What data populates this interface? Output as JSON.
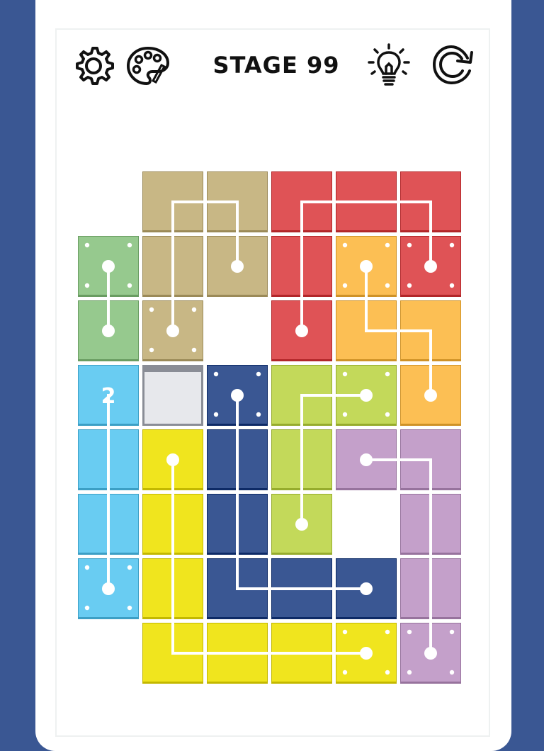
{
  "header": {
    "stage_label": "STAGE 99",
    "settings_icon": "gear-icon",
    "palette_icon": "palette-icon",
    "hint_icon": "lightbulb-icon",
    "restart_icon": "restart-icon"
  },
  "colors": {
    "background": "#3a5793",
    "tan": "#c8b785",
    "red": "#df5356",
    "green": "#96c98e",
    "orange": "#fcbf54",
    "lime": "#c3d95a",
    "navy": "#3a5793",
    "sky": "#69ccf2",
    "yellow": "#f0e51e",
    "purple": "#c4a0ca",
    "empty": "#e7e8ec",
    "path_line": "#ffffff"
  },
  "board": {
    "rows": 8,
    "cols": 6,
    "tiles": [
      {
        "r": 0,
        "c": 1,
        "color": "tan"
      },
      {
        "r": 0,
        "c": 2,
        "color": "tan"
      },
      {
        "r": 0,
        "c": 3,
        "color": "red"
      },
      {
        "r": 0,
        "c": 4,
        "color": "red"
      },
      {
        "r": 0,
        "c": 5,
        "color": "red"
      },
      {
        "r": 1,
        "c": 0,
        "color": "green",
        "endpoint": true
      },
      {
        "r": 1,
        "c": 1,
        "color": "tan"
      },
      {
        "r": 1,
        "c": 2,
        "color": "tan"
      },
      {
        "r": 1,
        "c": 3,
        "color": "red"
      },
      {
        "r": 1,
        "c": 4,
        "color": "orange",
        "endpoint": true
      },
      {
        "r": 1,
        "c": 5,
        "color": "red",
        "endpoint": true
      },
      {
        "r": 2,
        "c": 0,
        "color": "green"
      },
      {
        "r": 2,
        "c": 1,
        "color": "tan",
        "endpoint": true
      },
      {
        "r": 2,
        "c": 3,
        "color": "red"
      },
      {
        "r": 2,
        "c": 4,
        "color": "orange"
      },
      {
        "r": 2,
        "c": 5,
        "color": "orange"
      },
      {
        "r": 3,
        "c": 0,
        "color": "sky",
        "label": "2"
      },
      {
        "r": 3,
        "c": 1,
        "color": "empty"
      },
      {
        "r": 3,
        "c": 2,
        "color": "navy",
        "endpoint": true
      },
      {
        "r": 3,
        "c": 3,
        "color": "lime"
      },
      {
        "r": 3,
        "c": 4,
        "color": "lime",
        "endpoint": true
      },
      {
        "r": 3,
        "c": 5,
        "color": "orange"
      },
      {
        "r": 4,
        "c": 0,
        "color": "sky"
      },
      {
        "r": 4,
        "c": 1,
        "color": "yellow"
      },
      {
        "r": 4,
        "c": 2,
        "color": "navy"
      },
      {
        "r": 4,
        "c": 3,
        "color": "lime"
      },
      {
        "r": 4,
        "c": 4,
        "color": "purple"
      },
      {
        "r": 4,
        "c": 5,
        "color": "purple"
      },
      {
        "r": 5,
        "c": 0,
        "color": "sky"
      },
      {
        "r": 5,
        "c": 1,
        "color": "yellow"
      },
      {
        "r": 5,
        "c": 2,
        "color": "navy"
      },
      {
        "r": 5,
        "c": 3,
        "color": "lime"
      },
      {
        "r": 5,
        "c": 5,
        "color": "purple"
      },
      {
        "r": 6,
        "c": 0,
        "color": "sky",
        "endpoint": true
      },
      {
        "r": 6,
        "c": 1,
        "color": "yellow"
      },
      {
        "r": 6,
        "c": 2,
        "color": "navy"
      },
      {
        "r": 6,
        "c": 3,
        "color": "navy"
      },
      {
        "r": 6,
        "c": 4,
        "color": "navy"
      },
      {
        "r": 6,
        "c": 5,
        "color": "purple"
      },
      {
        "r": 7,
        "c": 1,
        "color": "yellow"
      },
      {
        "r": 7,
        "c": 2,
        "color": "yellow"
      },
      {
        "r": 7,
        "c": 3,
        "color": "yellow"
      },
      {
        "r": 7,
        "c": 4,
        "color": "yellow",
        "endpoint": true
      },
      {
        "r": 7,
        "c": 5,
        "color": "purple",
        "endpoint": true
      }
    ],
    "paths": [
      {
        "color": "green",
        "cells": [
          [
            1,
            0
          ],
          [
            2,
            0
          ]
        ]
      },
      {
        "color": "tan",
        "cells": [
          [
            2,
            1
          ],
          [
            0,
            1
          ],
          [
            0,
            2
          ],
          [
            1,
            2
          ]
        ]
      },
      {
        "color": "red",
        "cells": [
          [
            2,
            3
          ],
          [
            0,
            3
          ],
          [
            0,
            5
          ],
          [
            1,
            5
          ]
        ]
      },
      {
        "color": "orange",
        "cells": [
          [
            1,
            4
          ],
          [
            2,
            4
          ],
          [
            2,
            5
          ],
          [
            3,
            5
          ]
        ]
      },
      {
        "color": "lime",
        "cells": [
          [
            3,
            4
          ],
          [
            3,
            3
          ],
          [
            5,
            3
          ]
        ]
      },
      {
        "color": "sky",
        "cells": [
          [
            3,
            0
          ],
          [
            6,
            0
          ]
        ]
      },
      {
        "color": "yellow",
        "cells": [
          [
            4,
            1
          ],
          [
            7,
            1
          ],
          [
            7,
            4
          ]
        ]
      },
      {
        "color": "navy",
        "cells": [
          [
            3,
            2
          ],
          [
            6,
            2
          ],
          [
            6,
            4
          ]
        ]
      },
      {
        "color": "purple",
        "cells": [
          [
            4,
            4
          ],
          [
            4,
            5
          ],
          [
            7,
            5
          ]
        ]
      }
    ]
  }
}
